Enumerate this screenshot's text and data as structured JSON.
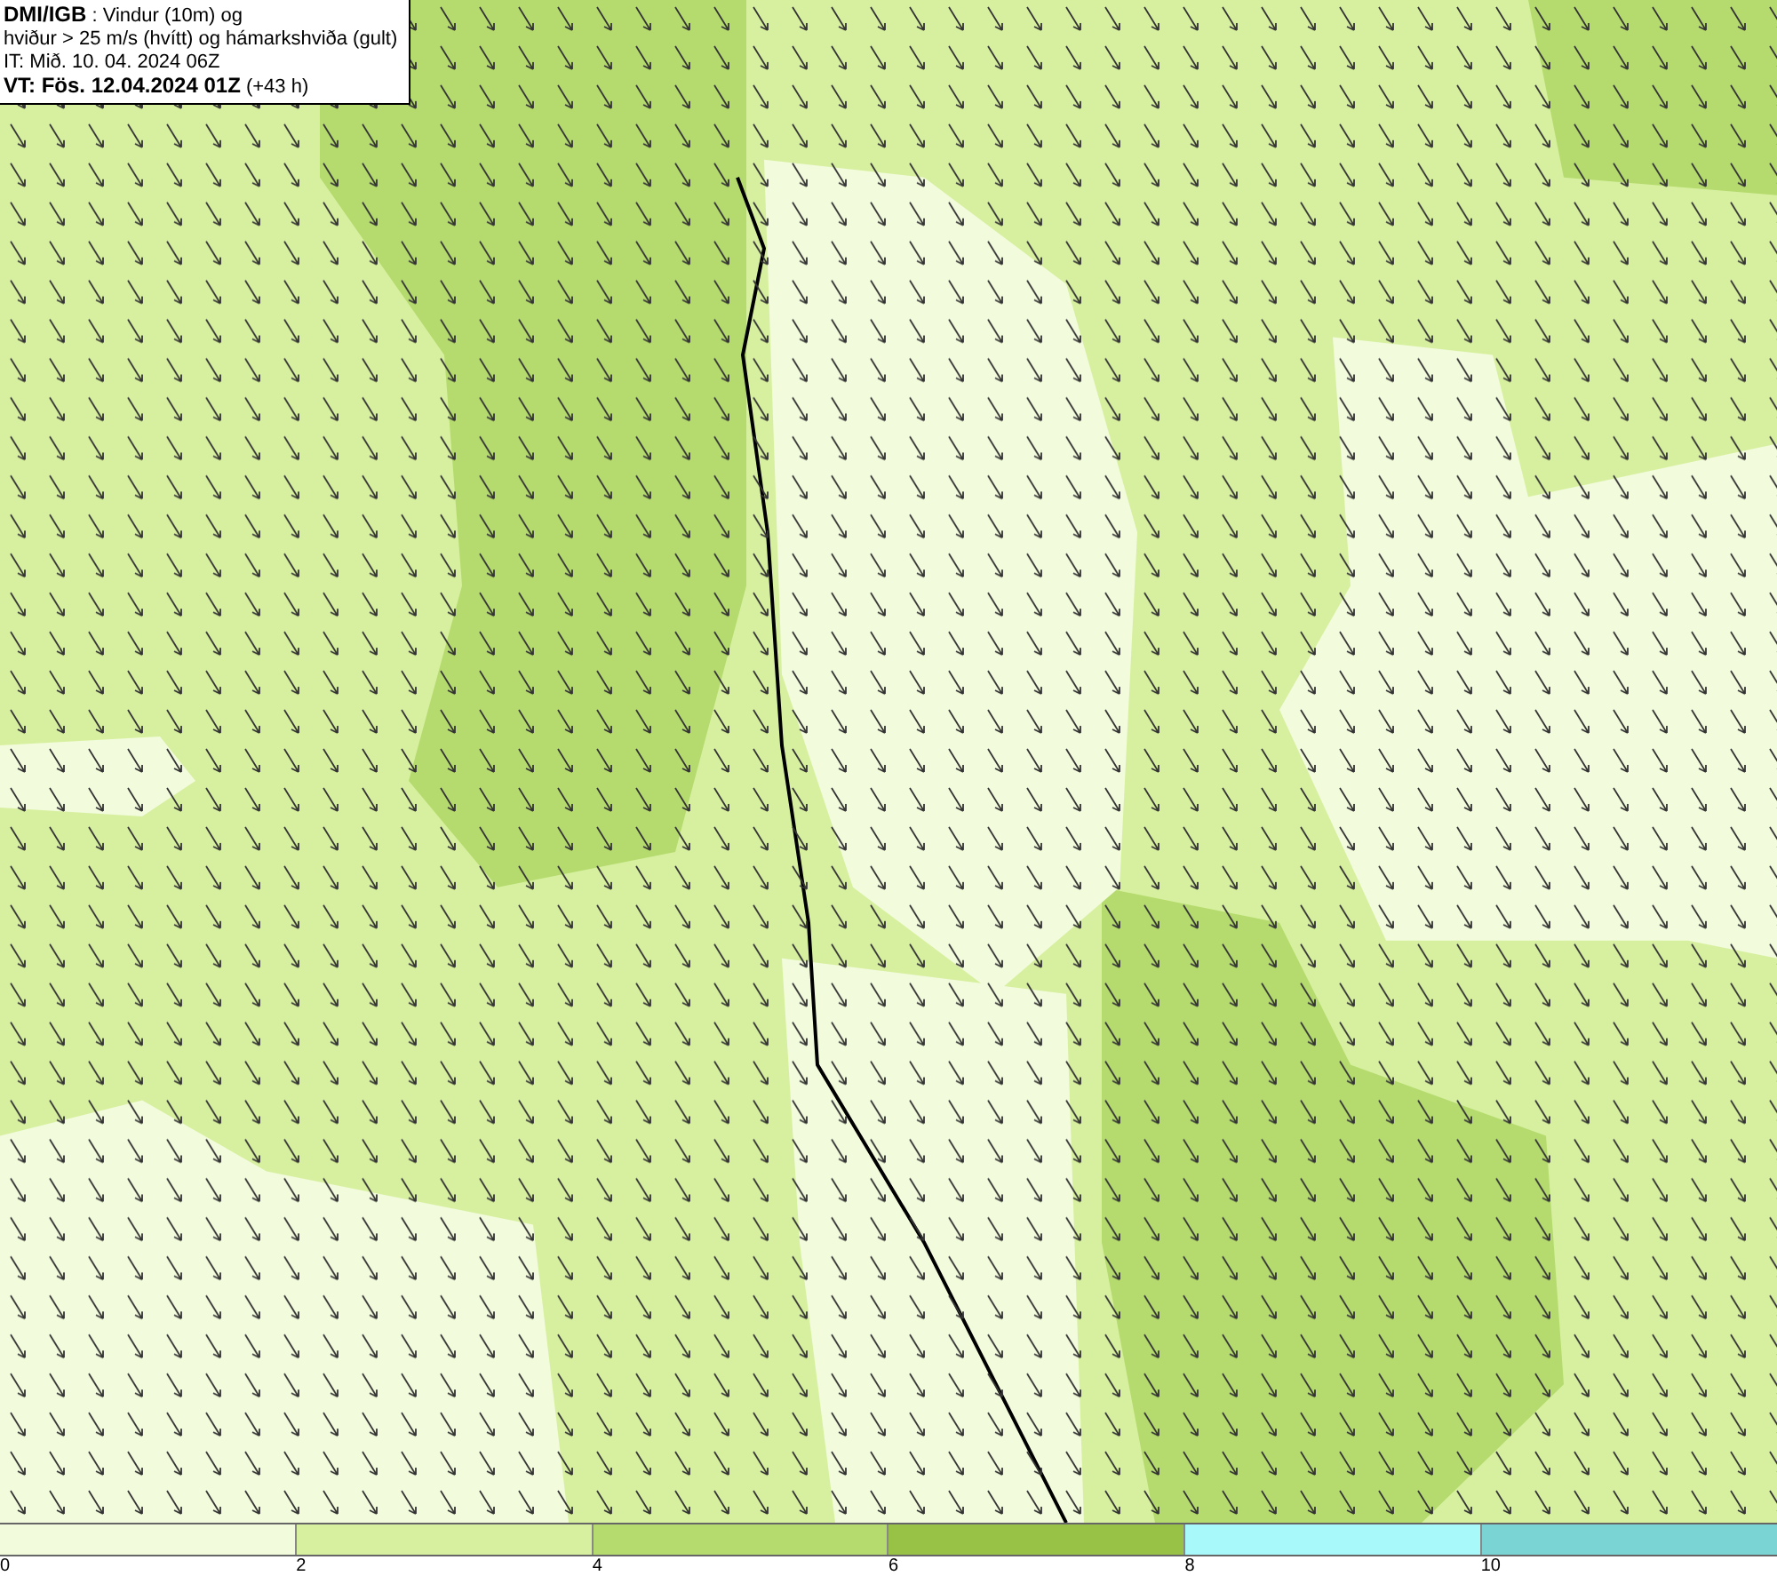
{
  "info_box": {
    "lines": [
      "**DMI/IGB** : Vindur (10m) og",
      "hviður > 25 m/s (hvítt) og hámarkshviða (gult)",
      "IT: Mið. 10. 04. 2024 06Z",
      "**VT: Fös. 12.04.2024 01Z** (+43 h)"
    ]
  },
  "legend": {
    "items": [
      {
        "label": "0",
        "color": "#f2fbdc"
      },
      {
        "label": "2",
        "color": "#d7f09f"
      },
      {
        "label": "4",
        "color": "#b5db6f"
      },
      {
        "label": "6",
        "color": "#97c246"
      },
      {
        "label": "8",
        "color": "#a8fafa"
      },
      {
        "label": "10",
        "color": "#7ad4d4"
      }
    ]
  }
}
